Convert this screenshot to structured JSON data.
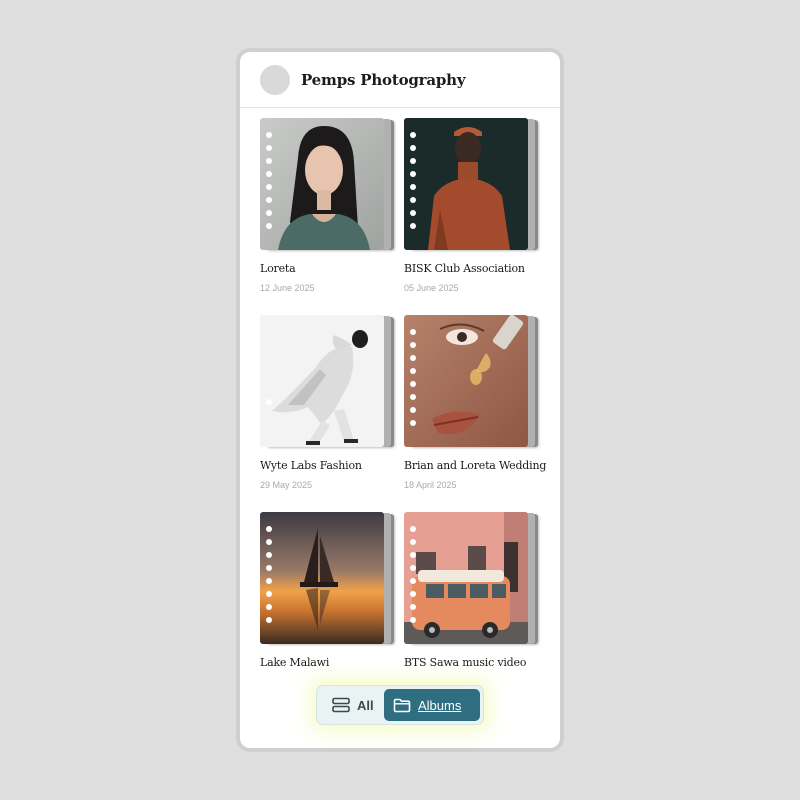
{
  "app": {
    "title": "Pemps Photography"
  },
  "albums": [
    {
      "title": "Loreta",
      "date": "12 June 2025",
      "photo": "portrait-woman-teal-top"
    },
    {
      "title": "BISK Club Association",
      "date": "05 June 2025",
      "photo": "dark-portrait-orange-turtleneck"
    },
    {
      "title": "Wyte Labs Fashion",
      "date": "29 May 2025",
      "photo": "white-coat-fashion-model"
    },
    {
      "title": "Brian and Loreta Wedding",
      "date": "18 April 2025",
      "photo": "face-closeup-serum-dropper"
    },
    {
      "title": "Lake Malawi",
      "date": "",
      "photo": "sailboat-sunset-lake"
    },
    {
      "title": "BTS Sawa music video",
      "date": "",
      "photo": "orange-van-pink-building"
    }
  ],
  "nav": {
    "all_label": "All",
    "albums_label": "Albums",
    "active": "Albums",
    "accent_color": "#2f6d80"
  }
}
